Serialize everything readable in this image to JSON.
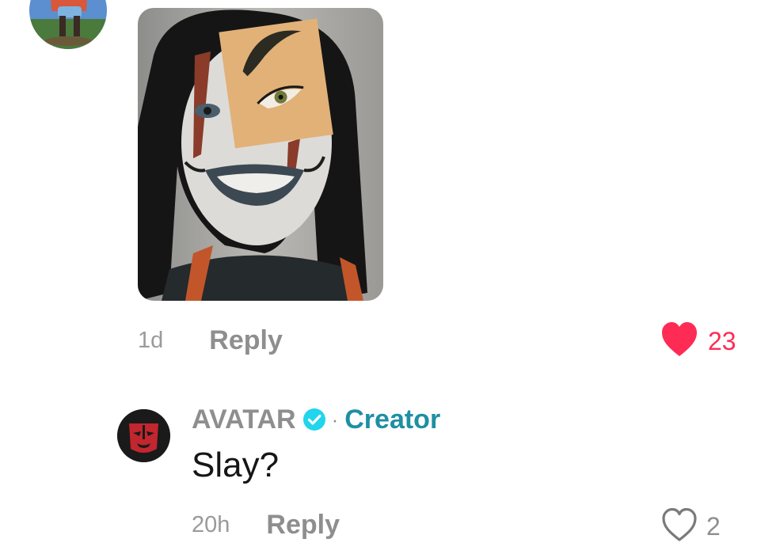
{
  "colors": {
    "like_active": "#fe2c55",
    "creator_label": "#1f8fa3",
    "verified_badge": "#20d5ec",
    "muted_text": "#8e8e8e"
  },
  "comment": {
    "time": "1d",
    "reply_label": "Reply",
    "likes": "23",
    "liked": true,
    "like_icon": "heart-filled-icon"
  },
  "reply": {
    "username": "AVATAR",
    "verified_icon": "verified-badge-icon",
    "separator": "·",
    "role": "Creator",
    "text": "Slay?",
    "time": "20h",
    "reply_label": "Reply",
    "likes": "2",
    "liked": false,
    "like_icon": "heart-outline-icon"
  }
}
